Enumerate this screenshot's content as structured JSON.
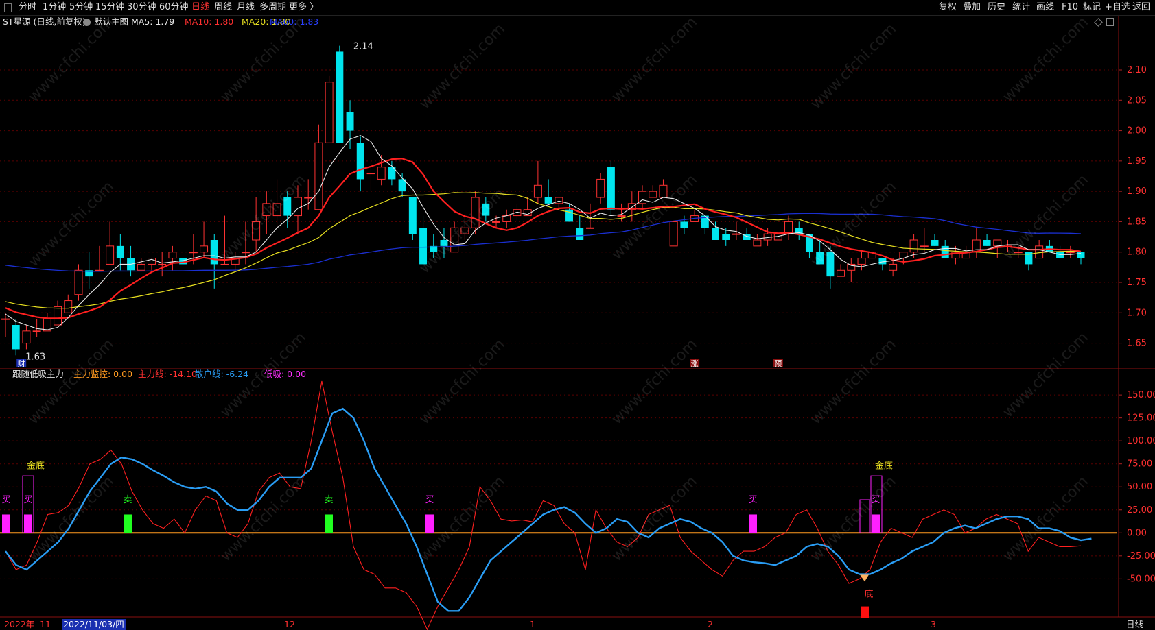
{
  "toolbar": {
    "periods": [
      "分时",
      "1分钟",
      "5分钟",
      "15分钟",
      "30分钟",
      "60分钟",
      "日线",
      "周线",
      "月线",
      "多周期",
      "更多 〉"
    ],
    "active_period": "日线",
    "right": [
      "复权",
      "叠加",
      "历史",
      "统计",
      "画线",
      "F10",
      "标记",
      "+自选",
      "返回"
    ]
  },
  "main_header": {
    "stock": "ST星源 (日线,前复权)",
    "template": "默认主图",
    "ma5": "MA5: 1.79",
    "ma10": "MA10: 1.80",
    "ma20": "MA20: 1.80",
    "ma60": "MA60: 1.83"
  },
  "sub_header": {
    "name": "跟随低吸主力",
    "monitor": "主力监控: 0.00",
    "main_line": "主力线: -14.10",
    "retail_line": "散户线: -6.24",
    "low_buy": "低吸: 0.00"
  },
  "colors": {
    "up": "#ff3232",
    "down": "#00e5ee",
    "ma5": "#e8e8e8",
    "ma10": "#ff2020",
    "ma20": "#e8e020",
    "ma60": "#1a2fd0",
    "retail": "#2a9df4"
  },
  "chart_data": [
    {
      "type": "candlestick",
      "ylim": [
        1.61,
        2.17
      ],
      "y_ticks": [
        "2.10",
        "2.05",
        "2.00",
        "1.95",
        "1.90",
        "1.85",
        "1.80",
        "1.75",
        "1.70",
        "1.65"
      ],
      "high_label": "2.14",
      "low_label": "1.63",
      "event_marks": [
        "财",
        "涨",
        "预"
      ],
      "candles": [
        [
          1.69,
          1.69,
          1.66,
          1.7
        ],
        [
          1.68,
          1.64,
          1.63,
          1.69
        ],
        [
          1.65,
          1.67,
          1.64,
          1.68
        ],
        [
          1.67,
          1.67,
          1.66,
          1.69
        ],
        [
          1.67,
          1.69,
          1.67,
          1.7
        ],
        [
          1.68,
          1.71,
          1.68,
          1.72
        ],
        [
          1.7,
          1.72,
          1.7,
          1.73
        ],
        [
          1.73,
          1.77,
          1.72,
          1.78
        ],
        [
          1.77,
          1.76,
          1.74,
          1.8
        ],
        [
          1.77,
          1.77,
          1.77,
          1.81
        ],
        [
          1.78,
          1.81,
          1.78,
          1.85
        ],
        [
          1.81,
          1.79,
          1.77,
          1.83
        ],
        [
          1.79,
          1.77,
          1.76,
          1.81
        ],
        [
          1.77,
          1.78,
          1.77,
          1.79
        ],
        [
          1.78,
          1.79,
          1.77,
          1.79
        ],
        [
          1.78,
          1.78,
          1.76,
          1.8
        ],
        [
          1.79,
          1.8,
          1.77,
          1.81
        ],
        [
          1.79,
          1.78,
          1.78,
          1.79
        ],
        [
          1.8,
          1.8,
          1.78,
          1.83
        ],
        [
          1.8,
          1.81,
          1.79,
          1.85
        ],
        [
          1.82,
          1.78,
          1.74,
          1.83
        ],
        [
          1.78,
          1.78,
          1.78,
          1.86
        ],
        [
          1.78,
          1.79,
          1.77,
          1.8
        ],
        [
          1.8,
          1.8,
          1.78,
          1.85
        ],
        [
          1.82,
          1.85,
          1.8,
          1.89
        ],
        [
          1.86,
          1.88,
          1.83,
          1.9
        ],
        [
          1.86,
          1.88,
          1.84,
          1.92
        ],
        [
          1.89,
          1.86,
          1.84,
          1.9
        ],
        [
          1.86,
          1.89,
          1.83,
          1.91
        ],
        [
          1.89,
          1.89,
          1.87,
          1.92
        ],
        [
          1.87,
          1.98,
          1.87,
          2.01
        ],
        [
          1.98,
          2.08,
          1.98,
          2.09
        ],
        [
          2.13,
          1.98,
          1.98,
          2.14
        ],
        [
          2.03,
          2.0,
          1.97,
          2.05
        ],
        [
          1.98,
          1.92,
          1.9,
          1.99
        ],
        [
          1.93,
          1.93,
          1.9,
          1.95
        ],
        [
          1.92,
          1.94,
          1.91,
          1.96
        ],
        [
          1.94,
          1.92,
          1.91,
          1.95
        ],
        [
          1.92,
          1.9,
          1.89,
          1.93
        ],
        [
          1.89,
          1.83,
          1.82,
          1.89
        ],
        [
          1.84,
          1.78,
          1.77,
          1.86
        ],
        [
          1.81,
          1.8,
          1.79,
          1.83
        ],
        [
          1.82,
          1.81,
          1.79,
          1.84
        ],
        [
          1.8,
          1.84,
          1.8,
          1.85
        ],
        [
          1.83,
          1.84,
          1.82,
          1.86
        ],
        [
          1.84,
          1.89,
          1.83,
          1.9
        ],
        [
          1.88,
          1.86,
          1.85,
          1.89
        ],
        [
          1.85,
          1.85,
          1.84,
          1.86
        ],
        [
          1.85,
          1.86,
          1.84,
          1.87
        ],
        [
          1.86,
          1.87,
          1.85,
          1.88
        ],
        [
          1.86,
          1.87,
          1.86,
          1.89
        ],
        [
          1.89,
          1.91,
          1.88,
          1.95
        ],
        [
          1.89,
          1.88,
          1.88,
          1.92
        ],
        [
          1.88,
          1.89,
          1.87,
          1.89
        ],
        [
          1.87,
          1.85,
          1.85,
          1.88
        ],
        [
          1.84,
          1.82,
          1.82,
          1.86
        ],
        [
          1.84,
          1.84,
          1.84,
          1.88
        ],
        [
          1.89,
          1.92,
          1.88,
          1.93
        ],
        [
          1.94,
          1.87,
          1.86,
          1.95
        ],
        [
          1.86,
          1.86,
          1.85,
          1.88
        ],
        [
          1.87,
          1.88,
          1.85,
          1.9
        ],
        [
          1.88,
          1.9,
          1.87,
          1.91
        ],
        [
          1.89,
          1.9,
          1.89,
          1.91
        ],
        [
          1.89,
          1.91,
          1.89,
          1.92
        ],
        [
          1.81,
          1.85,
          1.81,
          1.85
        ],
        [
          1.85,
          1.84,
          1.83,
          1.86
        ],
        [
          1.85,
          1.86,
          1.85,
          1.87
        ],
        [
          1.86,
          1.84,
          1.83,
          1.86
        ],
        [
          1.84,
          1.82,
          1.82,
          1.85
        ],
        [
          1.83,
          1.82,
          1.81,
          1.84
        ],
        [
          1.83,
          1.83,
          1.82,
          1.85
        ],
        [
          1.83,
          1.82,
          1.82,
          1.84
        ],
        [
          1.81,
          1.82,
          1.81,
          1.83
        ],
        [
          1.82,
          1.83,
          1.81,
          1.84
        ],
        [
          1.82,
          1.83,
          1.82,
          1.83
        ],
        [
          1.83,
          1.85,
          1.82,
          1.86
        ],
        [
          1.84,
          1.83,
          1.82,
          1.85
        ],
        [
          1.83,
          1.8,
          1.79,
          1.83
        ],
        [
          1.8,
          1.78,
          1.78,
          1.82
        ],
        [
          1.8,
          1.76,
          1.74,
          1.81
        ],
        [
          1.76,
          1.77,
          1.76,
          1.78
        ],
        [
          1.77,
          1.78,
          1.75,
          1.79
        ],
        [
          1.78,
          1.79,
          1.77,
          1.8
        ],
        [
          1.79,
          1.8,
          1.79,
          1.8
        ],
        [
          1.79,
          1.78,
          1.77,
          1.79
        ],
        [
          1.77,
          1.78,
          1.76,
          1.79
        ],
        [
          1.79,
          1.8,
          1.78,
          1.8
        ],
        [
          1.8,
          1.82,
          1.79,
          1.83
        ],
        [
          1.81,
          1.81,
          1.8,
          1.84
        ],
        [
          1.82,
          1.81,
          1.81,
          1.83
        ],
        [
          1.81,
          1.79,
          1.79,
          1.82
        ],
        [
          1.79,
          1.8,
          1.78,
          1.81
        ],
        [
          1.79,
          1.8,
          1.79,
          1.81
        ],
        [
          1.8,
          1.82,
          1.79,
          1.84
        ],
        [
          1.82,
          1.81,
          1.81,
          1.83
        ],
        [
          1.81,
          1.82,
          1.79,
          1.82
        ],
        [
          1.81,
          1.81,
          1.8,
          1.82
        ],
        [
          1.8,
          1.8,
          1.79,
          1.81
        ],
        [
          1.8,
          1.78,
          1.77,
          1.8
        ],
        [
          1.79,
          1.81,
          1.79,
          1.82
        ],
        [
          1.81,
          1.8,
          1.8,
          1.82
        ],
        [
          1.8,
          1.79,
          1.79,
          1.81
        ],
        [
          1.8,
          1.8,
          1.79,
          1.81
        ],
        [
          1.8,
          1.79,
          1.78,
          1.8
        ]
      ]
    },
    {
      "type": "line",
      "ylim": [
        -90,
        165
      ],
      "y_ticks": [
        "150.00",
        "125.00",
        "100.00",
        "75.00",
        "50.00",
        "25.00",
        "0.00",
        "-25.00",
        "-50.00"
      ],
      "series": [
        {
          "values": [
            -20,
            -40,
            -35,
            -10,
            20,
            22,
            30,
            50,
            75,
            80,
            90,
            75,
            45,
            25,
            10,
            5,
            15,
            0,
            25,
            40,
            35,
            0,
            -5,
            10,
            45,
            60,
            65,
            50,
            48,
            100,
            165,
            110,
            60,
            -15,
            -40,
            -45,
            -60,
            -60,
            -65,
            -80,
            -105,
            -80,
            -60,
            -40,
            -15,
            50,
            35,
            15,
            13,
            14,
            12,
            35,
            30,
            10,
            0,
            -40,
            25,
            5,
            -10,
            -15,
            -5,
            20,
            25,
            30,
            -5,
            -20,
            -30,
            -40,
            -47,
            -30,
            -20,
            -20,
            -15,
            -5,
            0,
            20,
            25,
            5,
            -20,
            -35,
            -55,
            -50,
            -40,
            -10,
            5,
            0,
            -5,
            15,
            20,
            25,
            20,
            0,
            5,
            15,
            20,
            15,
            10,
            -20,
            -5,
            -10,
            -15,
            -15,
            -14.1
          ]
        },
        {
          "values": [
            -20,
            -35,
            -40,
            -30,
            -20,
            -10,
            5,
            25,
            45,
            60,
            75,
            82,
            80,
            75,
            68,
            62,
            55,
            50,
            48,
            50,
            45,
            32,
            25,
            25,
            35,
            50,
            60,
            60,
            60,
            70,
            100,
            130,
            135,
            125,
            100,
            70,
            50,
            30,
            10,
            -15,
            -45,
            -75,
            -85,
            -85,
            -70,
            -50,
            -30,
            -20,
            -10,
            0,
            10,
            20,
            25,
            28,
            22,
            10,
            0,
            5,
            15,
            12,
            0,
            -5,
            5,
            10,
            15,
            12,
            5,
            0,
            -10,
            -25,
            -30,
            -32,
            -33,
            -35,
            -30,
            -25,
            -15,
            -12,
            -15,
            -25,
            -40,
            -45,
            -45,
            -40,
            -33,
            -28,
            -20,
            -15,
            -10,
            0,
            5,
            8,
            5,
            10,
            15,
            18,
            18,
            15,
            5,
            5,
            2,
            -5,
            -8,
            -6.24
          ]
        }
      ],
      "signal_text": [
        "买",
        "金底",
        "买",
        "卖",
        "卖",
        "买",
        "买",
        "金底",
        "买",
        "底"
      ]
    }
  ],
  "x_axis": {
    "labels": [
      "2022年",
      "11",
      "2022/11/03/四",
      "12",
      "1",
      "2",
      "3"
    ],
    "period_badge": "日线"
  },
  "watermark": "www.cfchi.com"
}
